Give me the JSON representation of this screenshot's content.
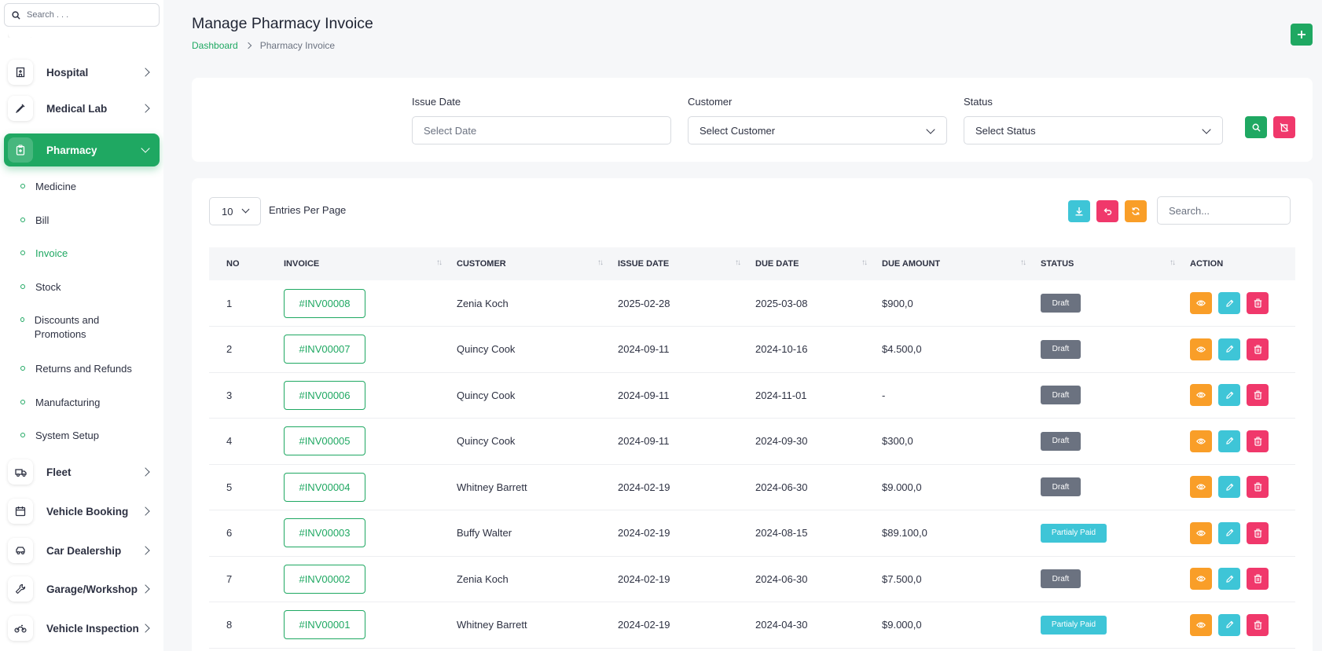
{
  "sidebar": {
    "search_placeholder": "Search . . .",
    "items": [
      {
        "label": "Hospital",
        "icon": "hospital-icon"
      },
      {
        "label": "Medical Lab",
        "icon": "syringe-icon"
      },
      {
        "label": "Pharmacy",
        "icon": "clipboard-plus-icon",
        "active": true
      },
      {
        "label": "Fleet",
        "icon": "truck-icon"
      },
      {
        "label": "Vehicle Booking",
        "icon": "calendar-icon"
      },
      {
        "label": "Car Dealership",
        "icon": "car-icon"
      },
      {
        "label": "Garage/Workshop",
        "icon": "wrench-icon"
      },
      {
        "label": "Vehicle Inspection",
        "icon": "motorcycle-icon"
      }
    ],
    "pharmacy_submenu": [
      {
        "label": "Medicine"
      },
      {
        "label": "Bill"
      },
      {
        "label": "Invoice",
        "active": true
      },
      {
        "label": "Stock"
      },
      {
        "label": "Discounts and Promotions"
      },
      {
        "label": "Returns and Refunds"
      },
      {
        "label": "Manufacturing"
      },
      {
        "label": "System Setup"
      }
    ]
  },
  "header": {
    "title": "Manage Pharmacy Invoice",
    "breadcrumb": {
      "home": "Dashboard",
      "current": "Pharmacy Invoice"
    }
  },
  "filters": {
    "issue_date": {
      "label": "Issue Date",
      "placeholder": "Select Date"
    },
    "customer": {
      "label": "Customer",
      "value": "Select Customer"
    },
    "status": {
      "label": "Status",
      "value": "Select Status"
    }
  },
  "table": {
    "entries_value": "10",
    "entries_label": "Entries Per Page",
    "search_placeholder": "Search...",
    "columns": [
      "NO",
      "INVOICE",
      "CUSTOMER",
      "ISSUE DATE",
      "DUE DATE",
      "DUE AMOUNT",
      "STATUS",
      "ACTION"
    ],
    "rows": [
      {
        "no": "1",
        "invoice": "#INV00008",
        "customer": "Zenia Koch",
        "issue_date": "2025-02-28",
        "due_date": "2025-03-08",
        "due_amount": "$900,0",
        "status": "Draft"
      },
      {
        "no": "2",
        "invoice": "#INV00007",
        "customer": "Quincy Cook",
        "issue_date": "2024-09-11",
        "due_date": "2024-10-16",
        "due_amount": "$4.500,0",
        "status": "Draft"
      },
      {
        "no": "3",
        "invoice": "#INV00006",
        "customer": "Quincy Cook",
        "issue_date": "2024-09-11",
        "due_date": "2024-11-01",
        "due_amount": "-",
        "status": "Draft"
      },
      {
        "no": "4",
        "invoice": "#INV00005",
        "customer": "Quincy Cook",
        "issue_date": "2024-09-11",
        "due_date": "2024-09-30",
        "due_amount": "$300,0",
        "status": "Draft"
      },
      {
        "no": "5",
        "invoice": "#INV00004",
        "customer": "Whitney Barrett",
        "issue_date": "2024-02-19",
        "due_date": "2024-06-30",
        "due_amount": "$9.000,0",
        "status": "Draft"
      },
      {
        "no": "6",
        "invoice": "#INV00003",
        "customer": "Buffy Walter",
        "issue_date": "2024-02-19",
        "due_date": "2024-08-15",
        "due_amount": "$89.100,0",
        "status": "Partialy Paid"
      },
      {
        "no": "7",
        "invoice": "#INV00002",
        "customer": "Zenia Koch",
        "issue_date": "2024-02-19",
        "due_date": "2024-06-30",
        "due_amount": "$7.500,0",
        "status": "Draft"
      },
      {
        "no": "8",
        "invoice": "#INV00001",
        "customer": "Whitney Barrett",
        "issue_date": "2024-02-19",
        "due_date": "2024-04-30",
        "due_amount": "$9.000,0",
        "status": "Partialy Paid"
      }
    ]
  },
  "colors": {
    "primary": "#1fa862",
    "cyan": "#3ec5d7",
    "orange": "#f99e28",
    "pink": "#f0386b",
    "draft": "#6b7280"
  }
}
